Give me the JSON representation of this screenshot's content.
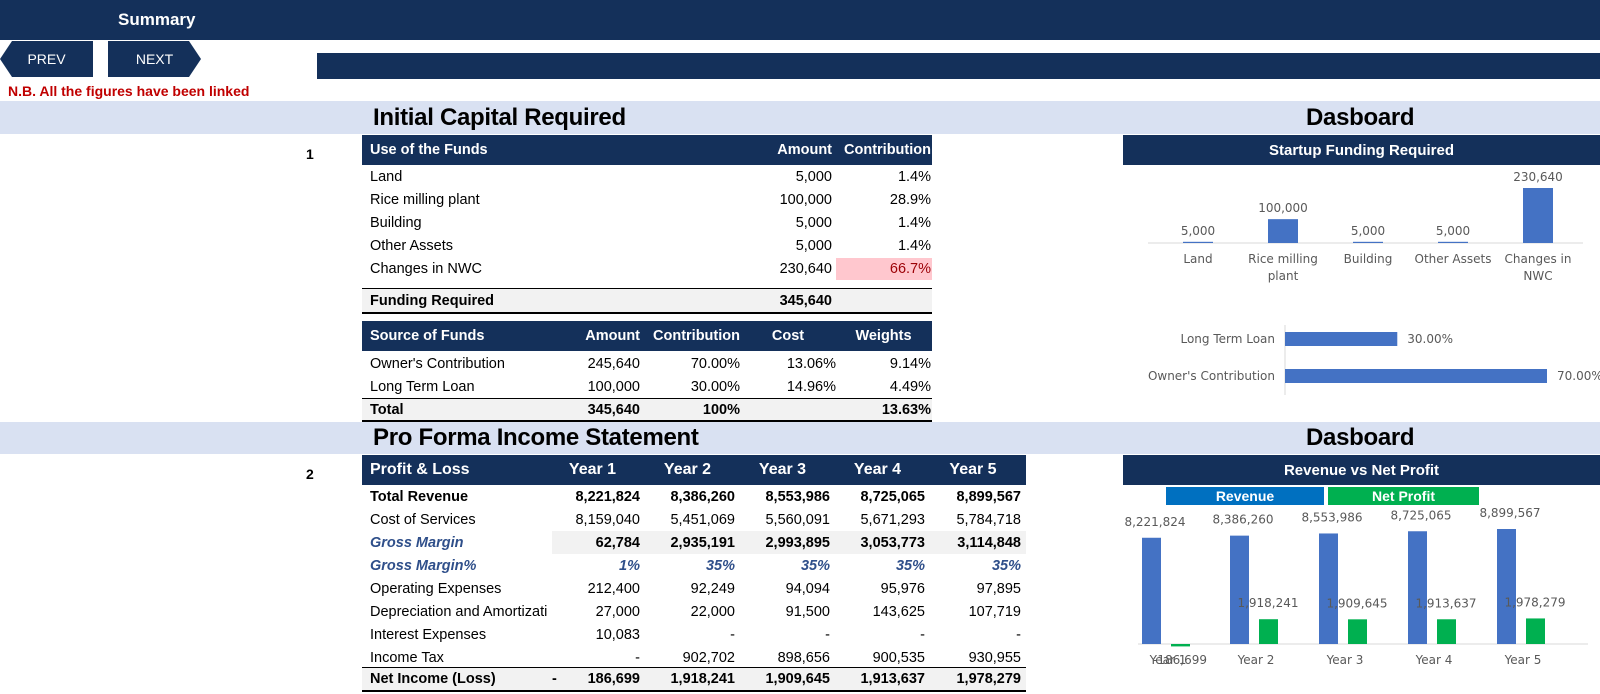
{
  "header": {
    "title": "Summary"
  },
  "nav": {
    "prev": "PREV",
    "next": "NEXT"
  },
  "note": "N.B. All the figures have been linked",
  "section1": {
    "number": "1",
    "title": "Initial Capital Required",
    "dashboard_title": "Dasboard",
    "uses": {
      "headers": [
        "Use of the Funds",
        "Amount",
        "Contribution"
      ],
      "rows": [
        [
          "Land",
          "5,000",
          "1.4%"
        ],
        [
          "Rice milling plant",
          "100,000",
          "28.9%"
        ],
        [
          "Building",
          "5,000",
          "1.4%"
        ],
        [
          "Other Assets",
          "5,000",
          "1.4%"
        ],
        [
          "Changes in NWC",
          "230,640",
          "66.7%"
        ]
      ],
      "total": [
        "Funding Required",
        "345,640"
      ]
    },
    "sources": {
      "headers": [
        "Source of Funds",
        "Amount",
        "Contribution",
        "Cost",
        "Weights"
      ],
      "rows": [
        [
          "Owner's Contribution",
          "245,640",
          "70.00%",
          "13.06%",
          "9.14%"
        ],
        [
          "Long Term Loan",
          "100,000",
          "30.00%",
          "14.96%",
          "4.49%"
        ]
      ],
      "total": [
        "Total",
        "345,640",
        "100%",
        "",
        "13.63%"
      ]
    }
  },
  "section2": {
    "number": "2",
    "title": "Pro Forma Income Statement",
    "dashboard_title": "Dasboard",
    "headers": [
      "Profit & Loss",
      "Year 1",
      "Year 2",
      "Year 3",
      "Year 4",
      "Year 5"
    ],
    "rows": [
      [
        "Total Revenue",
        "8,221,824",
        "8,386,260",
        "8,553,986",
        "8,725,065",
        "8,899,567"
      ],
      [
        "Cost of Services",
        "8,159,040",
        "5,451,069",
        "5,560,091",
        "5,671,293",
        "5,784,718"
      ],
      [
        "Gross Margin",
        "62,784",
        "2,935,191",
        "2,993,895",
        "3,053,773",
        "3,114,848"
      ],
      [
        "Gross Margin%",
        "1%",
        "35%",
        "35%",
        "35%",
        "35%"
      ],
      [
        "Operating Expenses",
        "212,400",
        "92,249",
        "94,094",
        "95,976",
        "97,895"
      ],
      [
        "Depreciation and Amortization",
        "27,000",
        "22,000",
        "91,500",
        "143,625",
        "107,719"
      ],
      [
        "Interest Expenses",
        "10,083",
        "-",
        "-",
        "-",
        "-"
      ],
      [
        "Income Tax",
        "-",
        "902,702",
        "898,656",
        "900,535",
        "930,955"
      ]
    ],
    "total": [
      "Net Income (Loss)",
      "-",
      "186,699",
      "1,918,241",
      "1,909,645",
      "1,913,637",
      "1,978,279"
    ]
  },
  "chart_data": [
    {
      "type": "bar",
      "title": "Startup Funding Required",
      "categories": [
        "Land",
        "Rice milling plant",
        "Building",
        "Other Assets",
        "Changes in NWC"
      ],
      "values": [
        5000,
        100000,
        5000,
        5000,
        230640
      ],
      "labels": [
        "5,000",
        "100,000",
        "5,000",
        "5,000",
        "230,640"
      ],
      "color": "#4472c4"
    },
    {
      "type": "bar",
      "orientation": "horizontal",
      "categories": [
        "Long Term Loan",
        "Owner's Contribution"
      ],
      "values": [
        30.0,
        70.0
      ],
      "labels": [
        "30.00%",
        "70.00%"
      ],
      "color": "#4472c4"
    },
    {
      "type": "bar",
      "title": "Revenue vs Net Profit",
      "categories": [
        "Year 1",
        "Year 2",
        "Year 3",
        "Year 4",
        "Year 5"
      ],
      "series": [
        {
          "name": "Revenue",
          "values": [
            8221824,
            8386260,
            8553986,
            8725065,
            8899567
          ],
          "labels": [
            "8,221,824",
            "8,386,260",
            "8,553,986",
            "8,725,065",
            "8,899,567"
          ],
          "color": "#4472c4"
        },
        {
          "name": "Net Profit",
          "values": [
            -186699,
            1918241,
            1909645,
            1913637,
            1978279
          ],
          "labels": [
            "-186,699",
            "1,918,241",
            "1,909,645",
            "1,913,637",
            "1,978,279"
          ],
          "color": "#00b050"
        }
      ],
      "legend": "top"
    }
  ],
  "colors": {
    "navy": "#14305a",
    "band": "#d9e1f2",
    "note": "#c00000",
    "highlight": "#ffc7ce",
    "highlight_text": "#9c0006"
  }
}
